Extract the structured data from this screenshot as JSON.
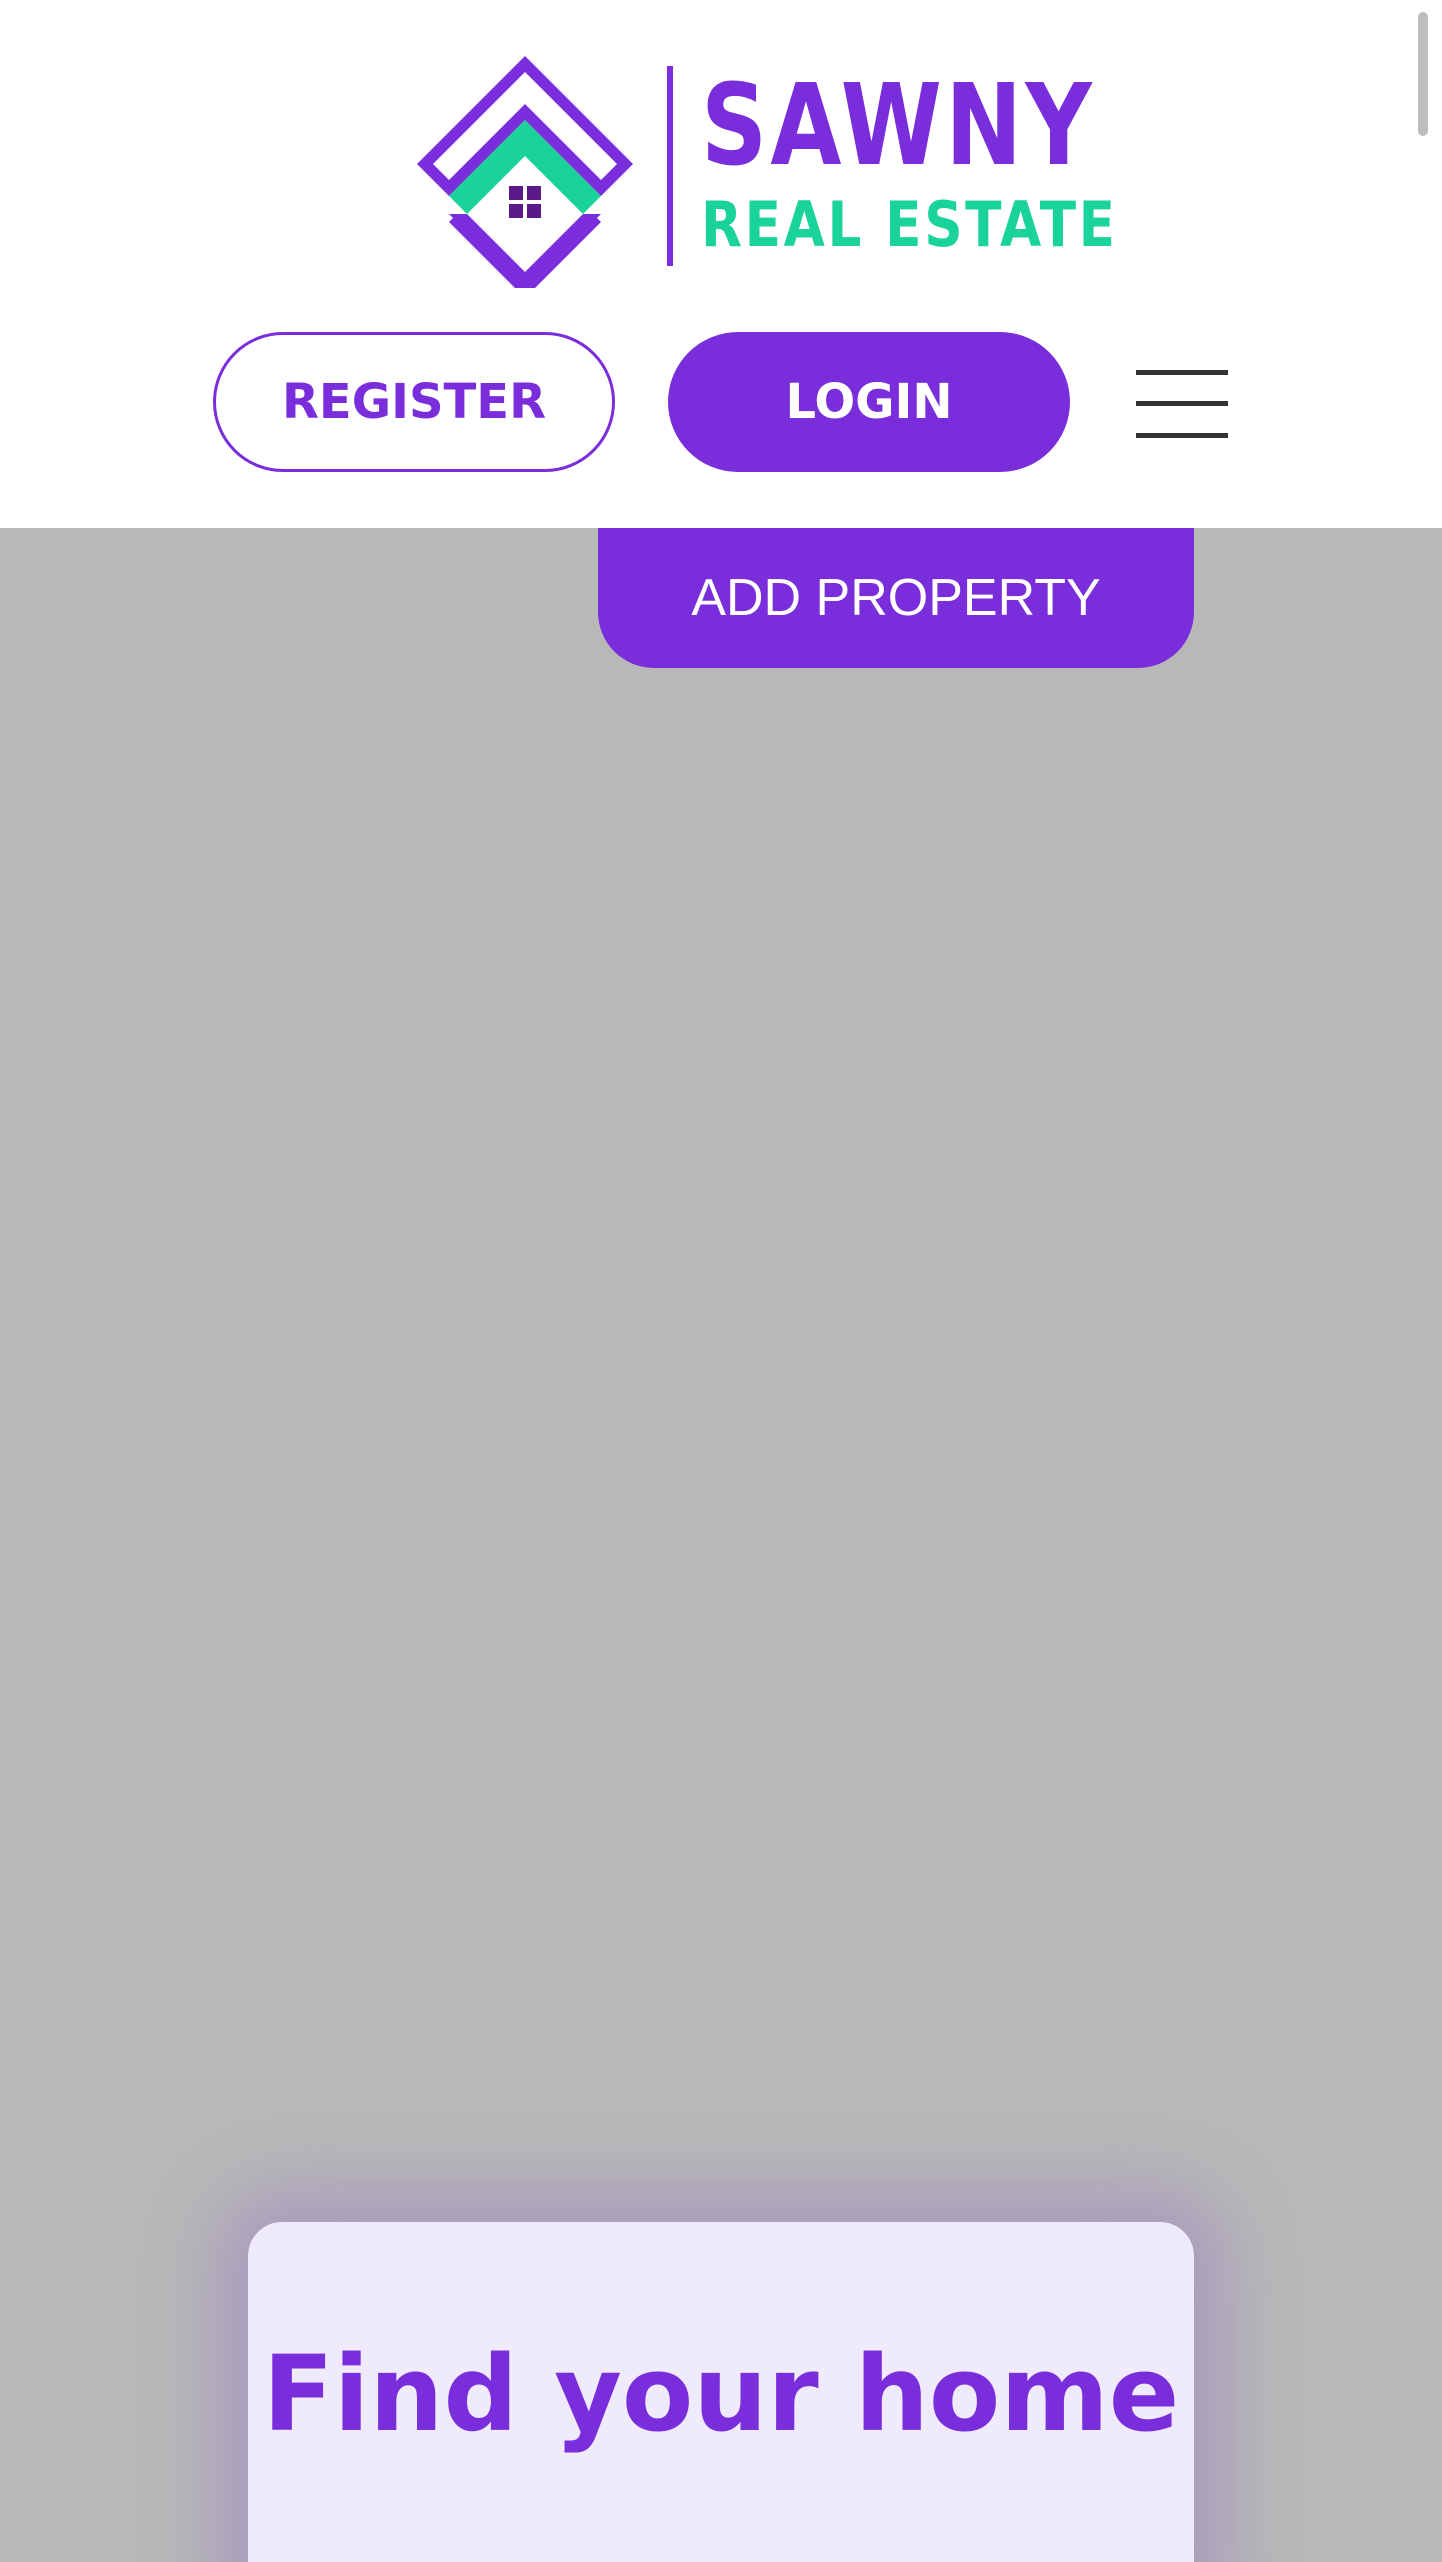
{
  "header": {
    "logo": {
      "brand": "SAWNY",
      "tagline": "REAL ESTATE"
    },
    "register_label": "REGISTER",
    "login_label": "LOGIN",
    "menu_icon": "hamburger-menu-icon"
  },
  "hero": {
    "add_property_label": "ADD PROPERTY",
    "search_title": "Find your home"
  },
  "colors": {
    "brand_purple": "#7a2ddb",
    "brand_green": "#19d39a",
    "hero_background": "#b8b8b8",
    "card_background": "#efeafc"
  }
}
